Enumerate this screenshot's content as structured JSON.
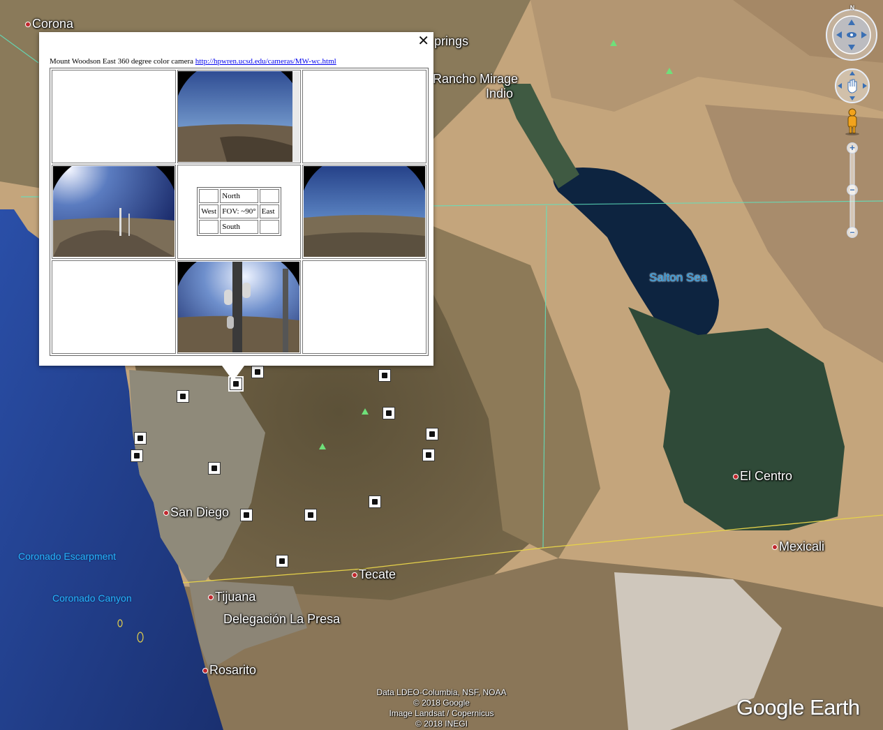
{
  "popup": {
    "caption": "Mount Woodson East 360 degree color camera",
    "link": "http://hpwren.ucsd.edu/cameras/MW-wc.html",
    "close_icon": "close-icon",
    "compass": {
      "north": "North",
      "west": "West",
      "fov": "FOV: ~90°",
      "east": "East",
      "south": "South"
    }
  },
  "places": {
    "corona": "Corona",
    "springs": "prings",
    "rancho_mirage": "Rancho Mirage",
    "indio": "Indio",
    "salton_sea": "Salton Sea",
    "el_centro": "El Centro",
    "mexicali": "Mexicali",
    "san_diego": "San Diego",
    "tecate": "Tecate",
    "tijuana": "Tijuana",
    "la_presa": "Delegación La Presa",
    "rosarito": "Rosarito",
    "coronado_escarpment": "Coronado Escarpment",
    "coronado_canyon": "Coronado Canyon"
  },
  "controls": {
    "north_label": "N",
    "zoom_in": "+",
    "zoom_out": "−"
  },
  "attribution": {
    "line1": "Data LDEO-Columbia, NSF, NOAA",
    "line2": "© 2018 Google",
    "line3": "Image Landsat / Copernicus",
    "line4": "© 2018 INEGI"
  },
  "brand": "Google Earth",
  "colors": {
    "ocean": "#1f3f8a",
    "desert": "#c9ad85",
    "salton_sea": "#0d2440",
    "farmland": "#2f4a38",
    "border_line": "#e6d24a",
    "county_line": "#5fe3c0"
  }
}
